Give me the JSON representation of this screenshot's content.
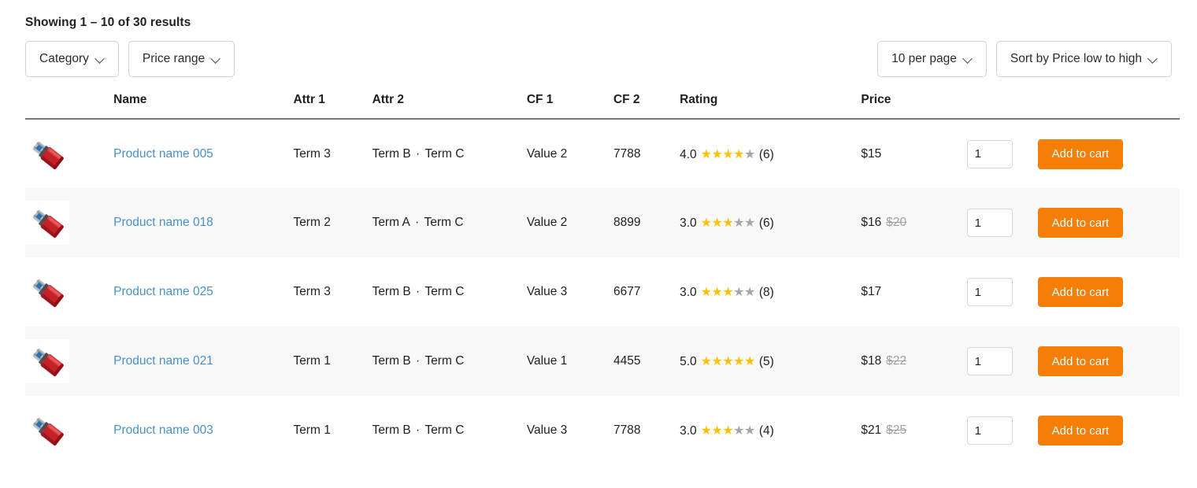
{
  "results_summary": "Showing 1 – 10 of 30 results",
  "filters": {
    "left": [
      {
        "label": "Category",
        "icon": "chevron-down-icon"
      },
      {
        "label": "Price range",
        "icon": "chevron-down-icon"
      }
    ],
    "right": [
      {
        "label": "10 per page",
        "icon": "chevron-down-icon"
      },
      {
        "label": "Sort by Price low to high",
        "icon": "chevron-down-icon"
      }
    ]
  },
  "table": {
    "headers": {
      "image": "",
      "name": "Name",
      "attr1": "Attr 1",
      "attr2": "Attr 2",
      "cf1": "CF 1",
      "cf2": "CF 2",
      "rating": "Rating",
      "price": "Price",
      "qty": "",
      "cart": ""
    },
    "separator": "·",
    "add_to_cart_label": "Add to cart",
    "quantity_value": "1",
    "colors": {
      "star_on": "#ffc107",
      "star_off": "#a6a6a6",
      "link": "#4a90c8",
      "button": "#f57e07",
      "old_price": "#a0a0a0",
      "row_stripe": "#f8f8f8"
    },
    "rows": [
      {
        "image_alt": "usb-flash-drive-thumbnail",
        "name": "Product name 005",
        "attr1": "Term 3",
        "attr2_a": "Term B",
        "attr2_b": "Term C",
        "cf1": "Value 2",
        "cf2": "7788",
        "rating_value": "4.0",
        "rating_stars_on": 4,
        "rating_stars_total": 5,
        "rating_count": "(6)",
        "price": "$15",
        "price_old": "",
        "qty": "1",
        "cart": "Add to cart"
      },
      {
        "image_alt": "usb-flash-drive-thumbnail",
        "name": "Product name 018",
        "attr1": "Term 2",
        "attr2_a": "Term A",
        "attr2_b": "Term C",
        "cf1": "Value 2",
        "cf2": "8899",
        "rating_value": "3.0",
        "rating_stars_on": 3,
        "rating_stars_total": 5,
        "rating_count": "(6)",
        "price": "$16",
        "price_old": "$20",
        "qty": "1",
        "cart": "Add to cart"
      },
      {
        "image_alt": "usb-flash-drive-thumbnail",
        "name": "Product name 025",
        "attr1": "Term 3",
        "attr2_a": "Term B",
        "attr2_b": "Term C",
        "cf1": "Value 3",
        "cf2": "6677",
        "rating_value": "3.0",
        "rating_stars_on": 3,
        "rating_stars_total": 5,
        "rating_count": "(8)",
        "price": "$17",
        "price_old": "",
        "qty": "1",
        "cart": "Add to cart"
      },
      {
        "image_alt": "usb-flash-drive-thumbnail",
        "name": "Product name 021",
        "attr1": "Term 1",
        "attr2_a": "Term B",
        "attr2_b": "Term C",
        "cf1": "Value 1",
        "cf2": "4455",
        "rating_value": "5.0",
        "rating_stars_on": 5,
        "rating_stars_total": 5,
        "rating_count": "(5)",
        "price": "$18",
        "price_old": "$22",
        "qty": "1",
        "cart": "Add to cart"
      },
      {
        "image_alt": "usb-flash-drive-thumbnail",
        "name": "Product name 003",
        "attr1": "Term 1",
        "attr2_a": "Term B",
        "attr2_b": "Term C",
        "cf1": "Value 3",
        "cf2": "7788",
        "rating_value": "3.0",
        "rating_stars_on": 3,
        "rating_stars_total": 5,
        "rating_count": "(4)",
        "price": "$21",
        "price_old": "$25",
        "qty": "1",
        "cart": "Add to cart"
      }
    ]
  }
}
